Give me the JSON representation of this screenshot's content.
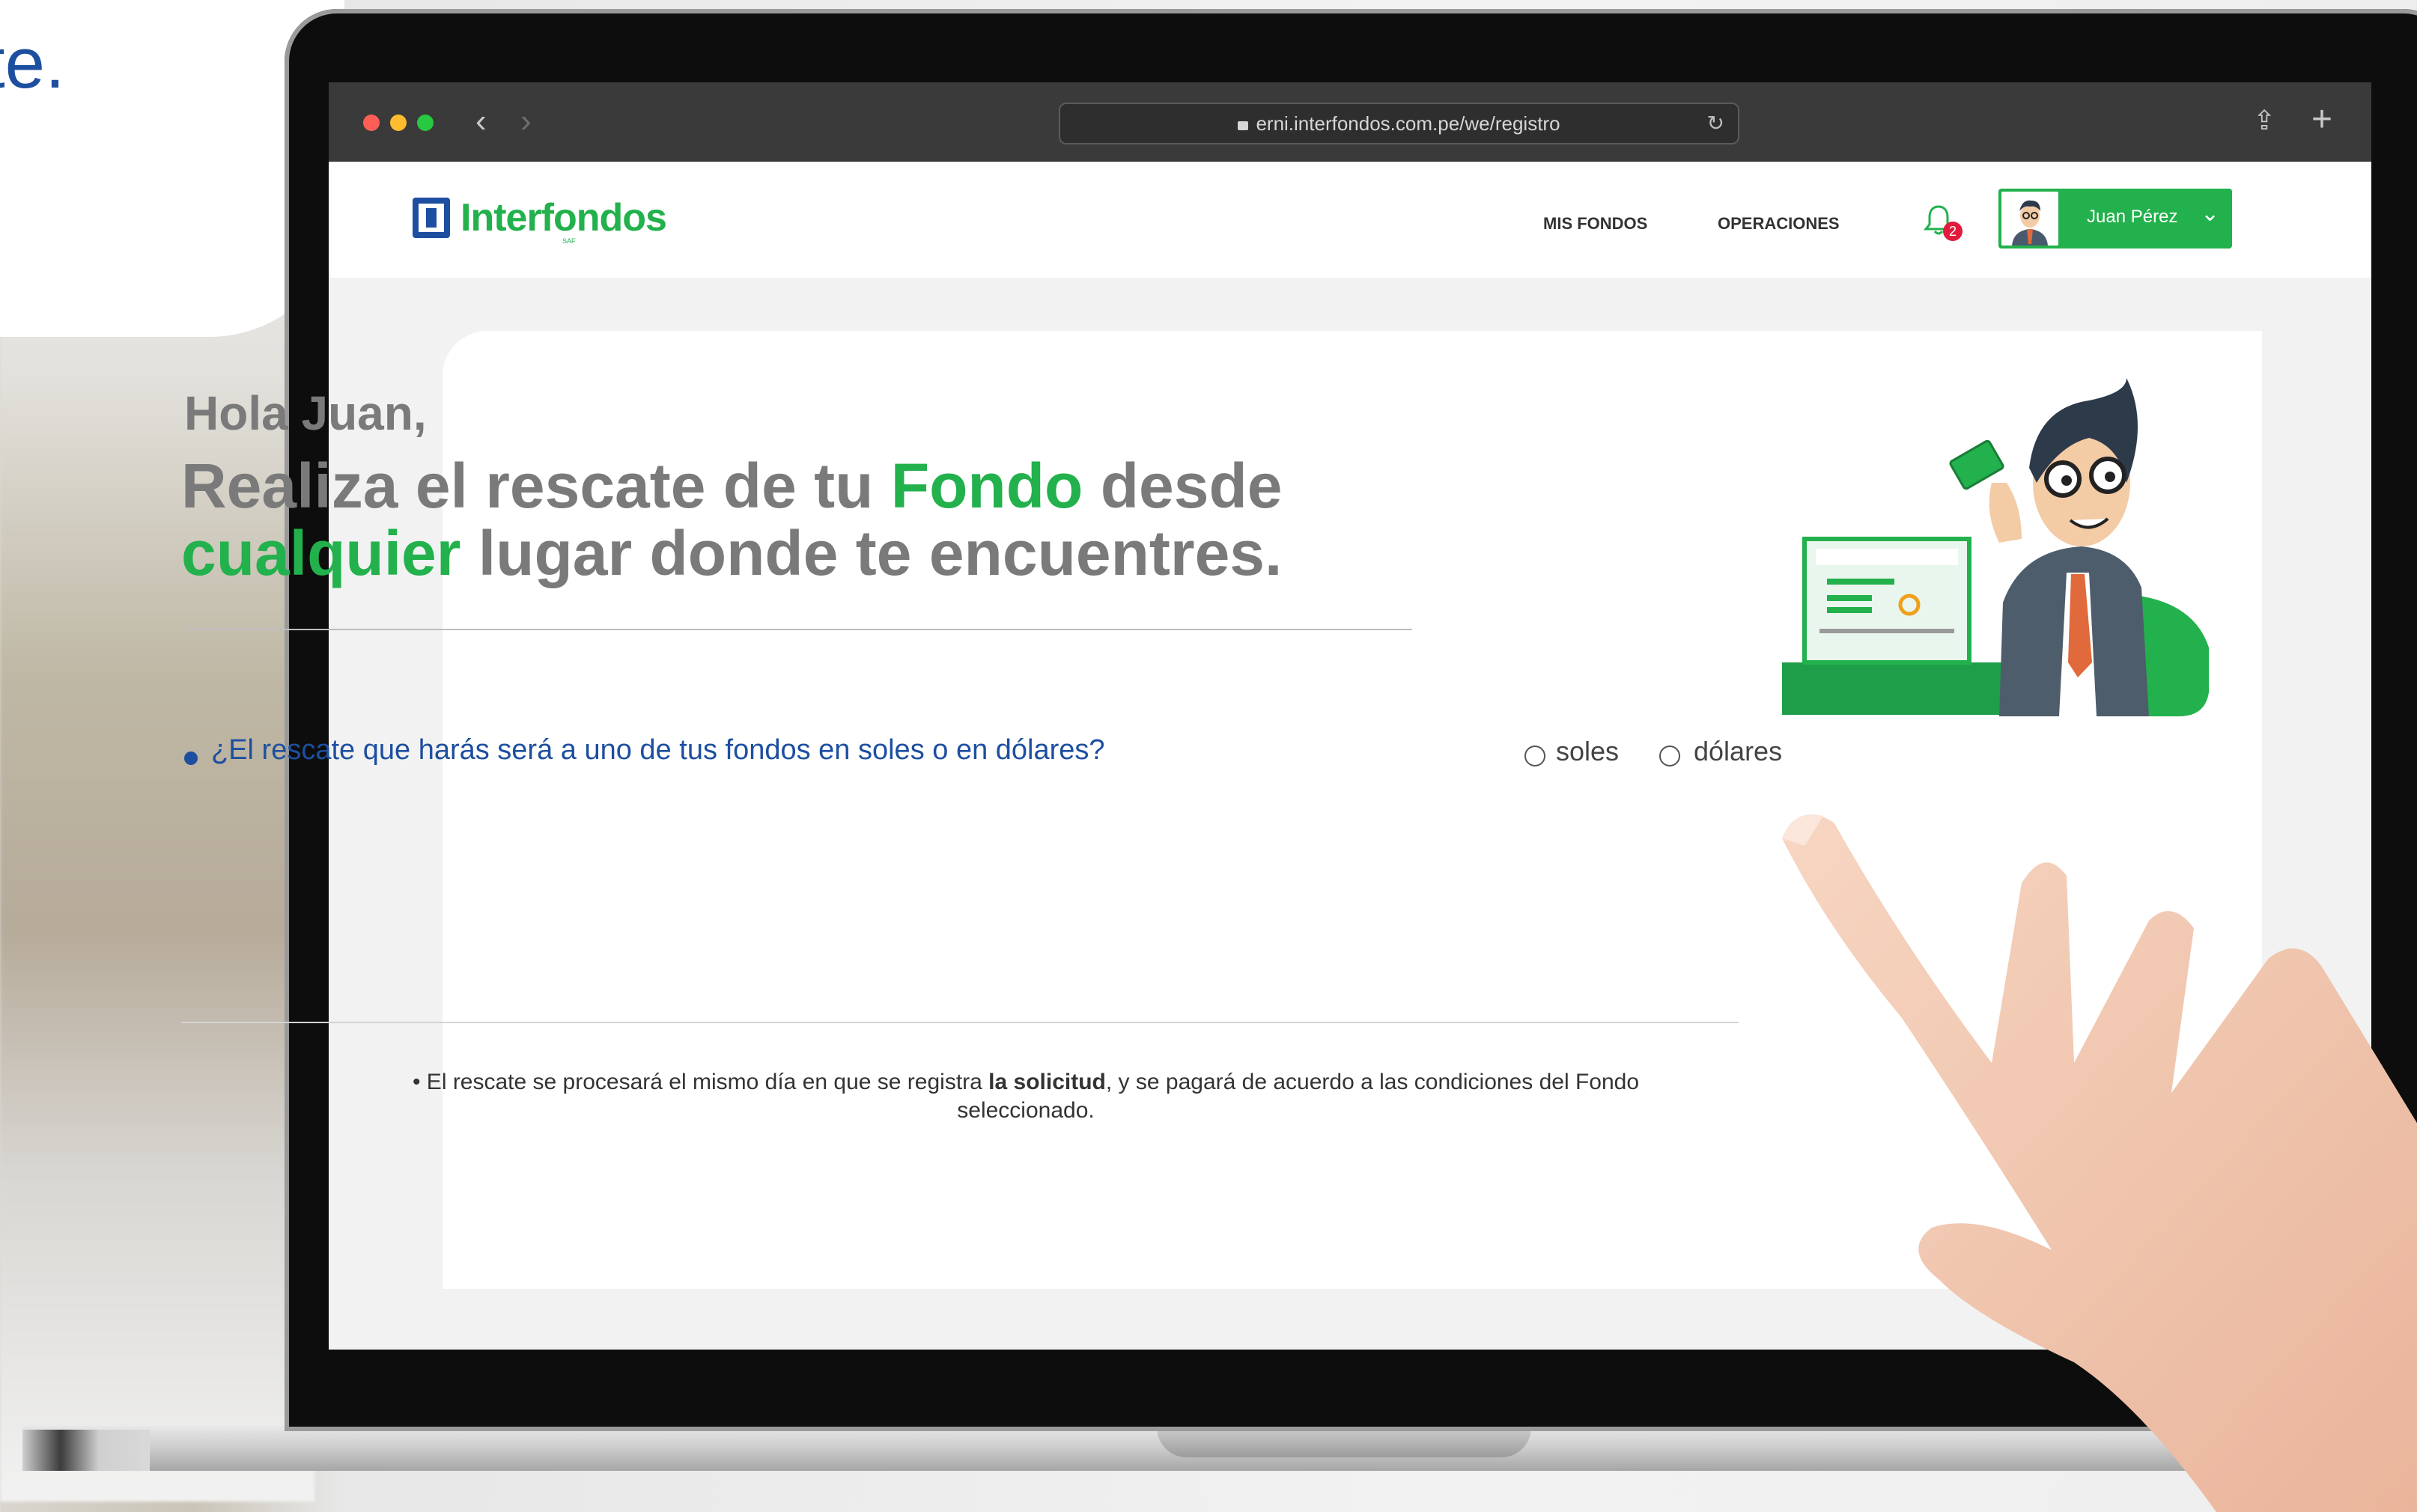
{
  "background": {
    "partial_text": "te."
  },
  "browser": {
    "url": "erni.interfondos.com.pe/we/registro",
    "traffic_lights": [
      "#fd5f57",
      "#febc2e",
      "#28c840"
    ],
    "icons": [
      "back-icon",
      "forward-icon",
      "lock-icon",
      "reload-icon",
      "share-icon",
      "new-tab-icon"
    ]
  },
  "header": {
    "logo_text": "Interfondos",
    "logo_sub": "SAF",
    "nav": [
      "MIS FONDOS",
      "OPERACIONES"
    ],
    "notification_count": "2",
    "user_name": "Juan Pérez"
  },
  "main": {
    "greeting": "Hola Juan,",
    "headline_1": "Realiza el rescate de tu ",
    "headline_hl1": "Fondo",
    "headline_2": " desde ",
    "headline_hl2": "cualquier",
    "headline_3": " lugar donde te encuentres.",
    "question": "¿El rescate que harás será a uno de tus fondos en soles o en dólares?",
    "options": [
      "soles",
      "dólares"
    ],
    "note_pre": "• El rescate se procesará el mismo día en que se registra ",
    "note_bold": "la solicitud",
    "note_post": ", y se pagará de acuerdo a las condiciones del Fondo seleccionado."
  },
  "colors": {
    "brand_green": "#22b14c",
    "brand_blue": "#1d4fa0",
    "badge_red": "#e11b3c"
  }
}
